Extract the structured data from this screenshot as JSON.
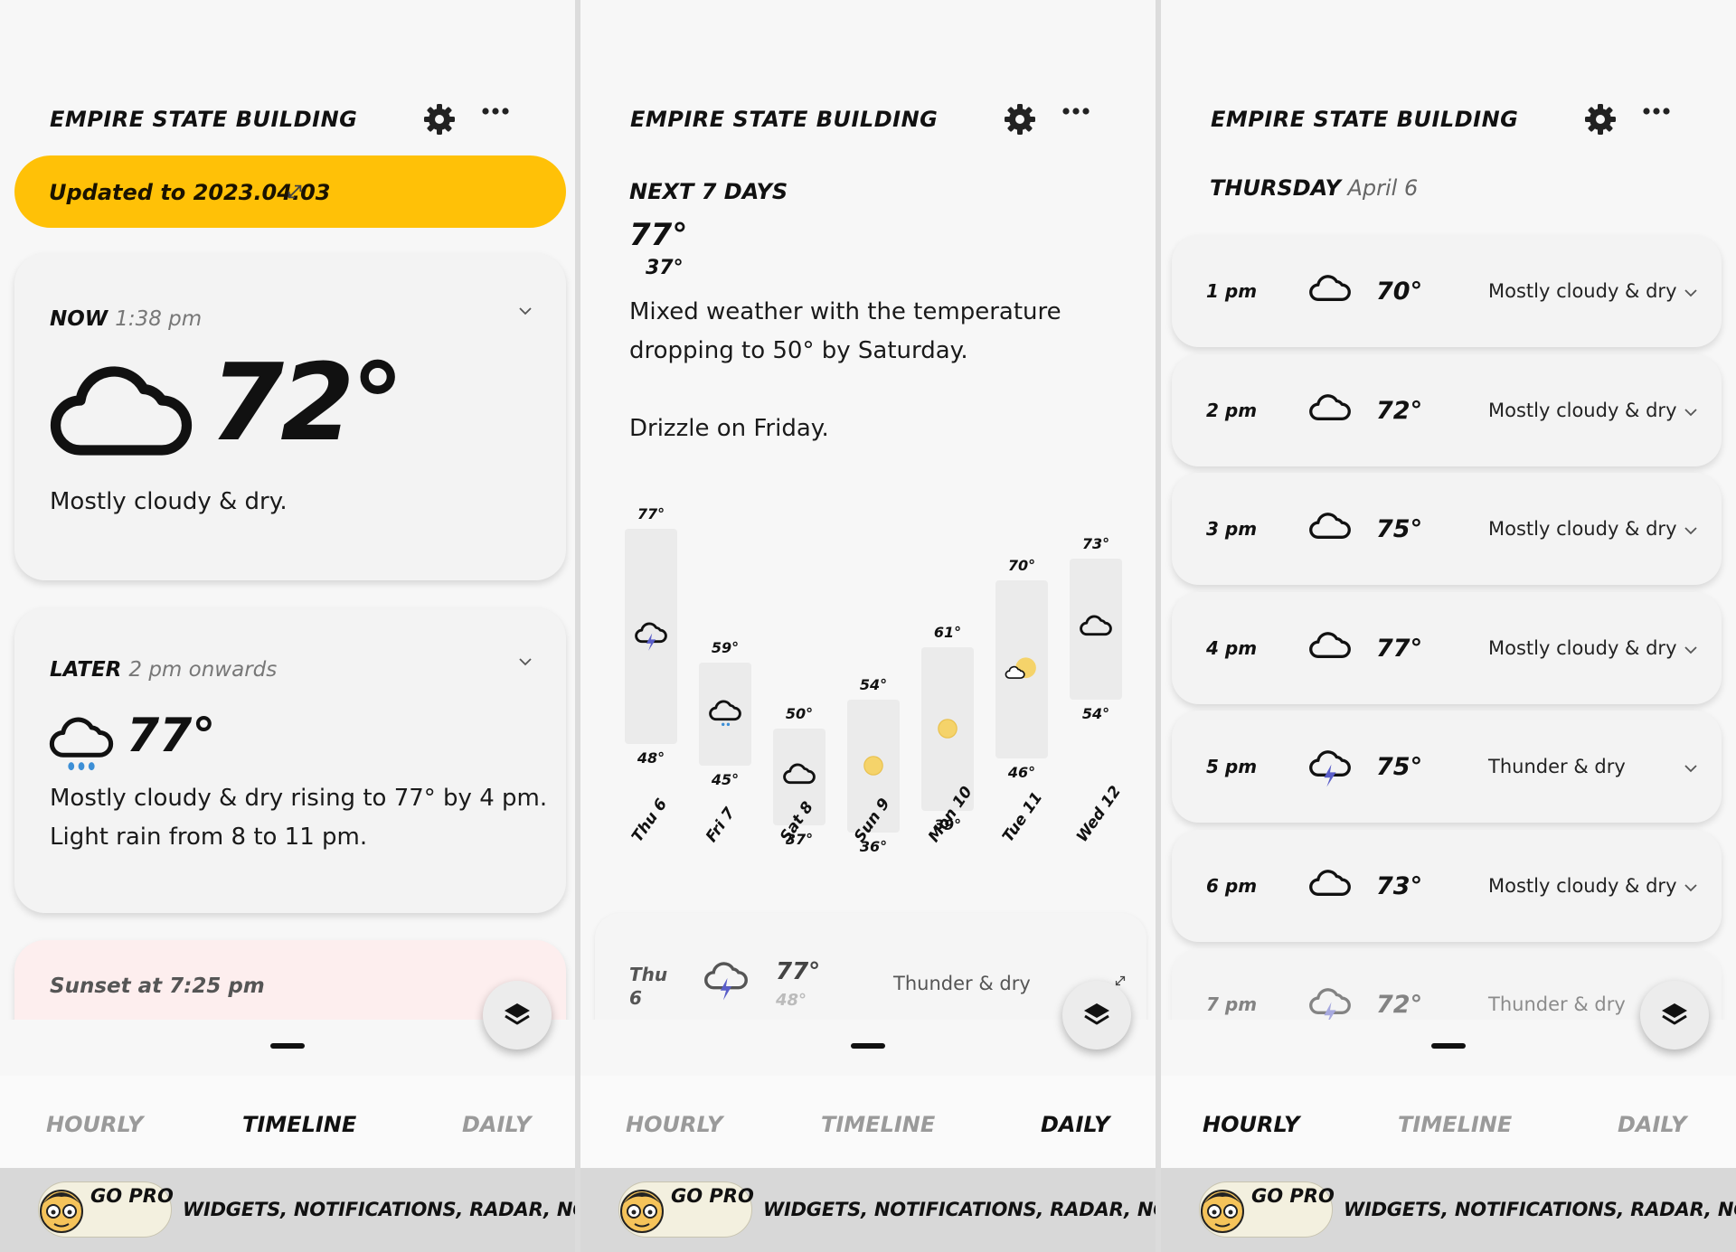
{
  "location": "EMPIRE STATE BUILDING",
  "tabs": [
    "HOURLY",
    "TIMELINE",
    "DAILY"
  ],
  "promo": {
    "badge": "GO PRO",
    "text": "WIDGETS, NOTIFICATIONS, RADAR, NO ADS"
  },
  "timeline": {
    "banner": "Updated to 2023.04.03",
    "now": {
      "label": "NOW",
      "time": "1:38 pm",
      "temp": "72°",
      "desc": "Mostly cloudy & dry."
    },
    "later": {
      "label": "LATER",
      "time": "2 pm onwards",
      "temp": "77°",
      "desc1": "Mostly cloudy & dry rising to 77° by 4 pm.",
      "desc2": "Light rain from 8 to 11 pm."
    },
    "sunset": "Sunset at 7:25 pm"
  },
  "daily": {
    "heading": "NEXT 7 DAYS",
    "high": "77°",
    "low": "37°",
    "summary1": "Mixed weather with the temperature",
    "summary2": "dropping to 50° by Saturday.",
    "summary3": "Drizzle on Friday.",
    "days": [
      {
        "label": "Thu 6",
        "high": "77°",
        "low": "48°",
        "hi": 77,
        "lo": 48,
        "icon": "cloud-thunder-icon"
      },
      {
        "label": "Fri 7",
        "high": "59°",
        "low": "45°",
        "hi": 59,
        "lo": 45,
        "icon": "cloud-drizzle-icon"
      },
      {
        "label": "Sat 8",
        "high": "50°",
        "low": "37°",
        "hi": 50,
        "lo": 37,
        "icon": "cloud-icon"
      },
      {
        "label": "Sun 9",
        "high": "54°",
        "low": "36°",
        "hi": 54,
        "lo": 36,
        "icon": "sun-icon"
      },
      {
        "label": "Mon 10",
        "high": "61°",
        "low": "39°",
        "hi": 61,
        "lo": 39,
        "icon": "sun-icon"
      },
      {
        "label": "Tue 11",
        "high": "70°",
        "low": "46°",
        "hi": 70,
        "lo": 46,
        "icon": "partly-sunny-icon"
      },
      {
        "label": "Wed 12",
        "high": "73°",
        "low": "54°",
        "hi": 73,
        "lo": 54,
        "icon": "cloud-icon"
      }
    ],
    "preview": {
      "day": "Thu",
      "date": "6",
      "high": "77°",
      "low": "48°",
      "desc": "Thunder & dry"
    }
  },
  "hourly": {
    "day": "THURSDAY",
    "date": "April 6",
    "rows": [
      {
        "time": "1 pm",
        "temp": "70°",
        "desc": "Mostly cloudy & dry",
        "icon": "cloud-icon"
      },
      {
        "time": "2 pm",
        "temp": "72°",
        "desc": "Mostly cloudy & dry",
        "icon": "cloud-icon"
      },
      {
        "time": "3 pm",
        "temp": "75°",
        "desc": "Mostly cloudy & dry",
        "icon": "cloud-icon"
      },
      {
        "time": "4 pm",
        "temp": "77°",
        "desc": "Mostly cloudy & dry",
        "icon": "cloud-icon"
      },
      {
        "time": "5 pm",
        "temp": "75°",
        "desc": "Thunder & dry",
        "icon": "cloud-thunder-icon"
      },
      {
        "time": "6 pm",
        "temp": "73°",
        "desc": "Mostly cloudy & dry",
        "icon": "cloud-icon"
      },
      {
        "time": "7 pm",
        "temp": "72°",
        "desc": "Thunder & dry",
        "icon": "cloud-thunder-icon"
      }
    ]
  },
  "colors": {
    "banner": "#ffc107",
    "sun": "#f5d36a",
    "bolt": "#5a5ec9",
    "rain": "#3d8fd6"
  }
}
